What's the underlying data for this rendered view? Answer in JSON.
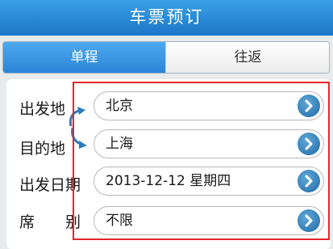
{
  "header": {
    "title": "车票预订"
  },
  "tabs": [
    {
      "label": "单程",
      "active": true
    },
    {
      "label": "往返",
      "active": false
    }
  ],
  "form": {
    "rows": [
      {
        "label": "出发地",
        "value": "北京"
      },
      {
        "label": "目的地",
        "value": "上海"
      },
      {
        "label": "出发日期",
        "value": "2013-12-12 星期四"
      },
      {
        "label": "席　　别",
        "value": "不限"
      }
    ]
  },
  "colors": {
    "header_bg": "#2a8ad8",
    "active_tab": "#3b96e2",
    "highlight_border": "#e3262b",
    "arrow_button": "#2f7cb8"
  },
  "icons": {
    "swap": "swap-arrows-icon",
    "row_arrow": "chevron-right-icon"
  }
}
